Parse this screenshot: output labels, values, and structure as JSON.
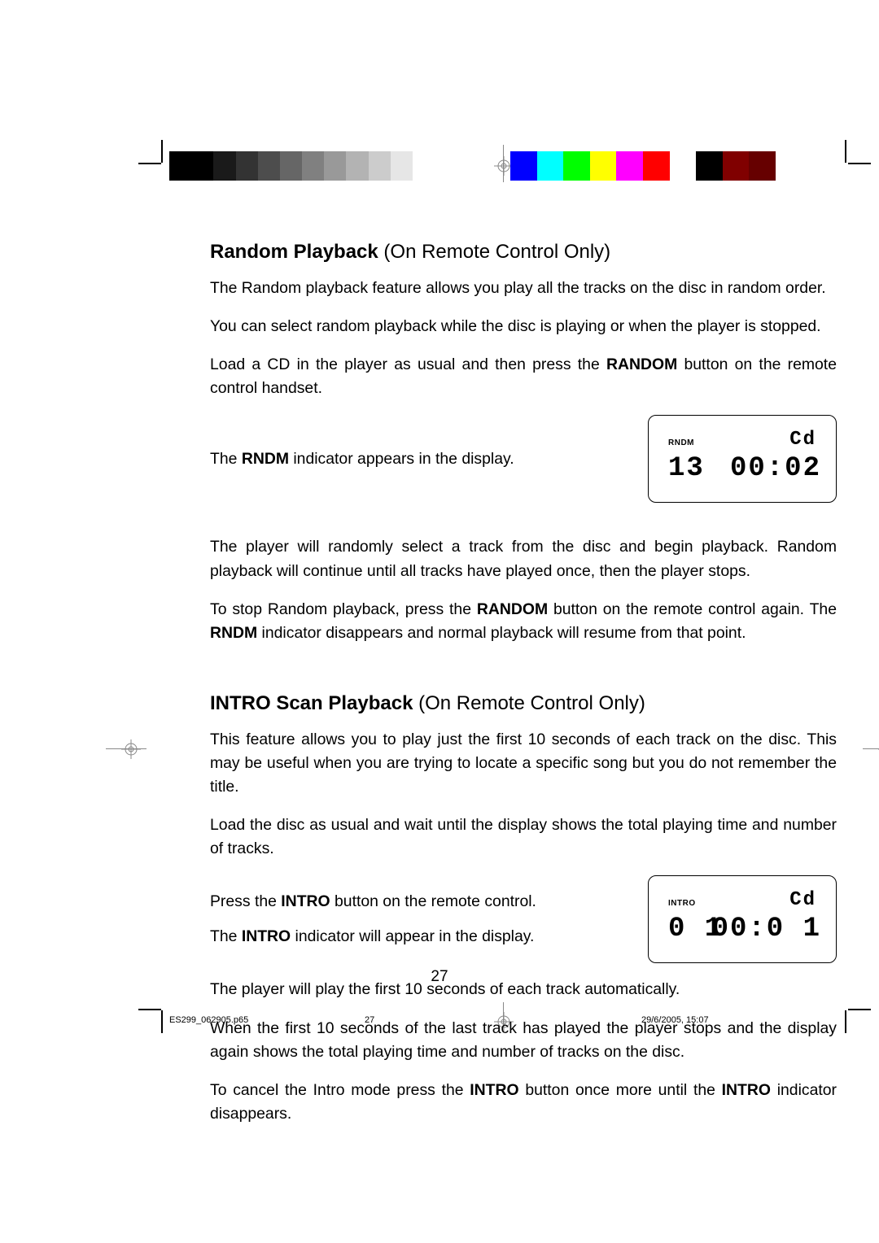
{
  "page_number": "27",
  "footer": {
    "filename": "ES299_062905.p65",
    "page": "27",
    "datetime": "29/6/2005, 15:07"
  },
  "section1": {
    "title_bold": "Random Playback",
    "title_rest": " (On Remote Control Only)",
    "p1": "The Random playback feature allows you play all the tracks on the disc in random order.",
    "p2": "You can select random playback while the disc is playing or when the player is stopped.",
    "p3a": "Load a CD in the player as usual and then press the ",
    "p3b": "RANDOM",
    "p3c": " button on the remote control handset.",
    "p4a": "The ",
    "p4b": "RNDM",
    "p4c": " indicator appears in the display.",
    "p5": "The player will randomly select a track from the disc and begin playback. Random playback will continue until all tracks have played once, then the player stops.",
    "p6a": "To stop Random playback, press the ",
    "p6b": "RANDOM",
    "p6c": " button on the remote control again. The ",
    "p6d": "RNDM",
    "p6e": " indicator disappears and normal playback will resume from that point."
  },
  "section2": {
    "title_bold": "INTRO Scan Playback",
    "title_rest": " (On Remote Control Only)",
    "p1": "This feature allows you to play just the first 10 seconds of each track on the disc. This may be useful when you are trying to locate a specific song but you do not remember the title.",
    "p2": "Load the disc as usual and wait until the display shows the total playing time and number of tracks.",
    "p3a": "Press the ",
    "p3b": "INTRO",
    "p3c": " button on the remote control.",
    "p4a": "The ",
    "p4b": "INTRO",
    "p4c": " indicator will appear in the display.",
    "p5": "The player will play the first 10 seconds of each track automatically.",
    "p6": "When the first 10 seconds of the last track has played the player stops and the display again shows the total playing time and number of tracks on the disc.",
    "p7a": "To cancel the Intro mode press the ",
    "p7b": "INTRO",
    "p7c": " button once more until the ",
    "p7d": "INTRO",
    "p7e": " indicator disappears."
  },
  "lcd1": {
    "indicator": "RNDM",
    "cd": "Cd",
    "track": "13",
    "time": "00:02"
  },
  "lcd2": {
    "indicator": "INTRO",
    "cd": "Cd",
    "track": "0 1",
    "time": "00:0 1"
  },
  "greys": [
    "#000000",
    "#000000",
    "#1a1a1a",
    "#333333",
    "#4d4d4d",
    "#666666",
    "#808080",
    "#999999",
    "#b3b3b3",
    "#cccccc",
    "#e6e6e6",
    "#ffffff"
  ],
  "colors": [
    "#0000ff",
    "#00ffff",
    "#00ff00",
    "#ffff00",
    "#ff00ff",
    "#ff0000",
    "#ffffff",
    "#000000",
    "#800000",
    "#660000"
  ]
}
